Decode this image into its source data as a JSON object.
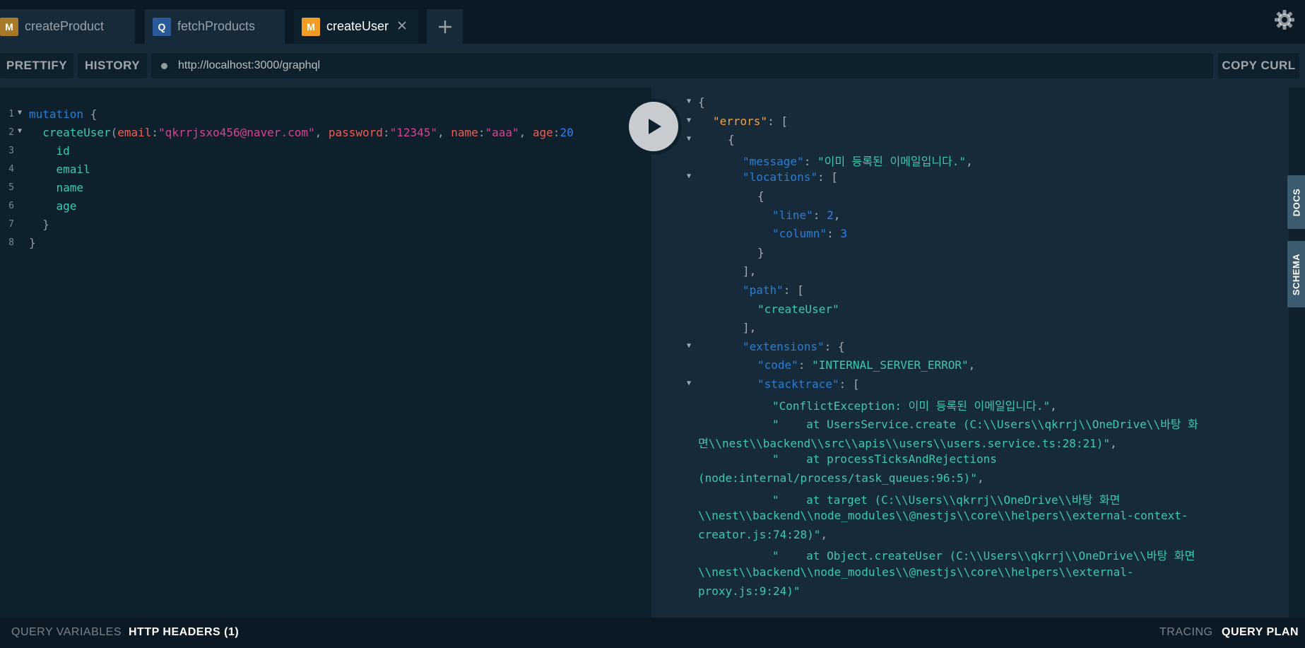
{
  "tabs": [
    {
      "badge": "M",
      "title": "createProduct",
      "badge_color": "#a67a28"
    },
    {
      "badge": "Q",
      "title": "fetchProducts",
      "badge_color": "#2a5a9a"
    },
    {
      "badge": "M",
      "title": "createUser",
      "badge_color": "#f19c23"
    }
  ],
  "icons": {
    "settings": "gear-icon",
    "add": "plus-icon",
    "close": "close-icon",
    "run": "play-icon"
  },
  "toolbar": {
    "prettify": "PRETTIFY",
    "history": "HISTORY",
    "url": "http://localhost:3000/graphql",
    "copy_curl": "COPY CURL"
  },
  "editor": {
    "line_numbers": [
      "1",
      "2",
      "3",
      "4",
      "5",
      "6",
      "7",
      "8"
    ],
    "line1": {
      "keyword": "mutation",
      "brace": "{"
    },
    "line2": {
      "fn": "createUser",
      "open": "(",
      "k_email": "email",
      "v_email": "\"qkrrjsxo456@naver.com\"",
      "k_password": "password",
      "v_password": "\"12345\"",
      "k_name": "name",
      "v_name": "\"aaa\"",
      "k_age": "age",
      "v_age": "20"
    },
    "fields": [
      "id",
      "email",
      "name",
      "age"
    ],
    "close_inner": "}",
    "close_outer": "}"
  },
  "result": {
    "lines": [
      {
        "indent": 0,
        "fold": true,
        "parts": [
          [
            "jp",
            "{"
          ]
        ]
      },
      {
        "indent": 1,
        "fold": true,
        "parts": [
          [
            "jerr",
            "\"errors\""
          ],
          [
            "jp",
            ": ["
          ]
        ]
      },
      {
        "indent": 2,
        "fold": true,
        "parts": [
          [
            "jp",
            "{"
          ]
        ]
      },
      {
        "indent": 3,
        "fold": false,
        "parts": [
          [
            "jkey",
            "\"message\""
          ],
          [
            "jp",
            ": "
          ],
          [
            "jstr",
            "\"이미 등록된 이메일입니다.\""
          ],
          [
            "jp",
            ","
          ]
        ]
      },
      {
        "indent": 3,
        "fold": true,
        "parts": [
          [
            "jkey",
            "\"locations\""
          ],
          [
            "jp",
            ": ["
          ]
        ]
      },
      {
        "indent": 4,
        "fold": false,
        "parts": [
          [
            "jp",
            "{"
          ]
        ]
      },
      {
        "indent": 5,
        "fold": false,
        "parts": [
          [
            "jkey",
            "\"line\""
          ],
          [
            "jp",
            ": "
          ],
          [
            "jnum",
            "2"
          ],
          [
            "jp",
            ","
          ]
        ]
      },
      {
        "indent": 5,
        "fold": false,
        "parts": [
          [
            "jkey",
            "\"column\""
          ],
          [
            "jp",
            ": "
          ],
          [
            "jnum",
            "3"
          ]
        ]
      },
      {
        "indent": 4,
        "fold": false,
        "parts": [
          [
            "jp",
            "}"
          ]
        ]
      },
      {
        "indent": 3,
        "fold": false,
        "parts": [
          [
            "jp",
            "],"
          ]
        ]
      },
      {
        "indent": 3,
        "fold": false,
        "parts": [
          [
            "jkey",
            "\"path\""
          ],
          [
            "jp",
            ": ["
          ]
        ]
      },
      {
        "indent": 4,
        "fold": false,
        "parts": [
          [
            "jstr",
            "\"createUser\""
          ]
        ]
      },
      {
        "indent": 3,
        "fold": false,
        "parts": [
          [
            "jp",
            "],"
          ]
        ]
      },
      {
        "indent": 3,
        "fold": true,
        "parts": [
          [
            "jkey",
            "\"extensions\""
          ],
          [
            "jp",
            ": {"
          ]
        ]
      },
      {
        "indent": 4,
        "fold": false,
        "parts": [
          [
            "jkey",
            "\"code\""
          ],
          [
            "jp",
            ": "
          ],
          [
            "jstr",
            "\"INTERNAL_SERVER_ERROR\""
          ],
          [
            "jp",
            ","
          ]
        ]
      },
      {
        "indent": 4,
        "fold": true,
        "parts": [
          [
            "jkey",
            "\"stacktrace\""
          ],
          [
            "jp",
            ": ["
          ]
        ]
      },
      {
        "indent": 5,
        "fold": false,
        "parts": [
          [
            "jstr",
            "\"ConflictException: 이미 등록된 이메일입니다.\""
          ],
          [
            "jp",
            ","
          ]
        ]
      },
      {
        "indent": 5,
        "fold": false,
        "parts": [
          [
            "jstr",
            "\"    at UsersService.create (C:\\\\Users\\\\qkrrj\\\\OneDrive\\\\바탕 화"
          ]
        ]
      },
      {
        "indent": 0,
        "fold": false,
        "parts": [
          [
            "jstr",
            "면\\\\nest\\\\backend\\\\src\\\\apis\\\\users\\\\users.service.ts:28:21)\""
          ],
          [
            "jp",
            ","
          ]
        ]
      },
      {
        "indent": 5,
        "fold": false,
        "parts": [
          [
            "jstr",
            "\"    at processTicksAndRejections"
          ]
        ]
      },
      {
        "indent": 0,
        "fold": false,
        "parts": [
          [
            "jstr",
            "(node:internal/process/task_queues:96:5)\""
          ],
          [
            "jp",
            ","
          ]
        ]
      },
      {
        "indent": 5,
        "fold": false,
        "parts": [
          [
            "jstr",
            "\"    at target (C:\\\\Users\\\\qkrrj\\\\OneDrive\\\\바탕 화면"
          ]
        ]
      },
      {
        "indent": 0,
        "fold": false,
        "parts": [
          [
            "jstr",
            "\\\\nest\\\\backend\\\\node_modules\\\\@nestjs\\\\core\\\\helpers\\\\external-context-"
          ]
        ]
      },
      {
        "indent": 0,
        "fold": false,
        "parts": [
          [
            "jstr",
            "creator.js:74:28)\""
          ],
          [
            "jp",
            ","
          ]
        ]
      },
      {
        "indent": 5,
        "fold": false,
        "parts": [
          [
            "jstr",
            "\"    at Object.createUser (C:\\\\Users\\\\qkrrj\\\\OneDrive\\\\바탕 화면"
          ]
        ]
      },
      {
        "indent": 0,
        "fold": false,
        "parts": [
          [
            "jstr",
            "\\\\nest\\\\backend\\\\node_modules\\\\@nestjs\\\\core\\\\helpers\\\\external-"
          ]
        ]
      },
      {
        "indent": 0,
        "fold": false,
        "parts": [
          [
            "jstr",
            "proxy.js:9:24)\""
          ]
        ]
      }
    ]
  },
  "sidetabs": {
    "docs": "DOCS",
    "schema": "SCHEMA"
  },
  "bottom": {
    "query_variables": "QUERY VARIABLES",
    "http_headers": "HTTP HEADERS (1)",
    "tracing": "TRACING",
    "query_plan": "QUERY PLAN"
  }
}
